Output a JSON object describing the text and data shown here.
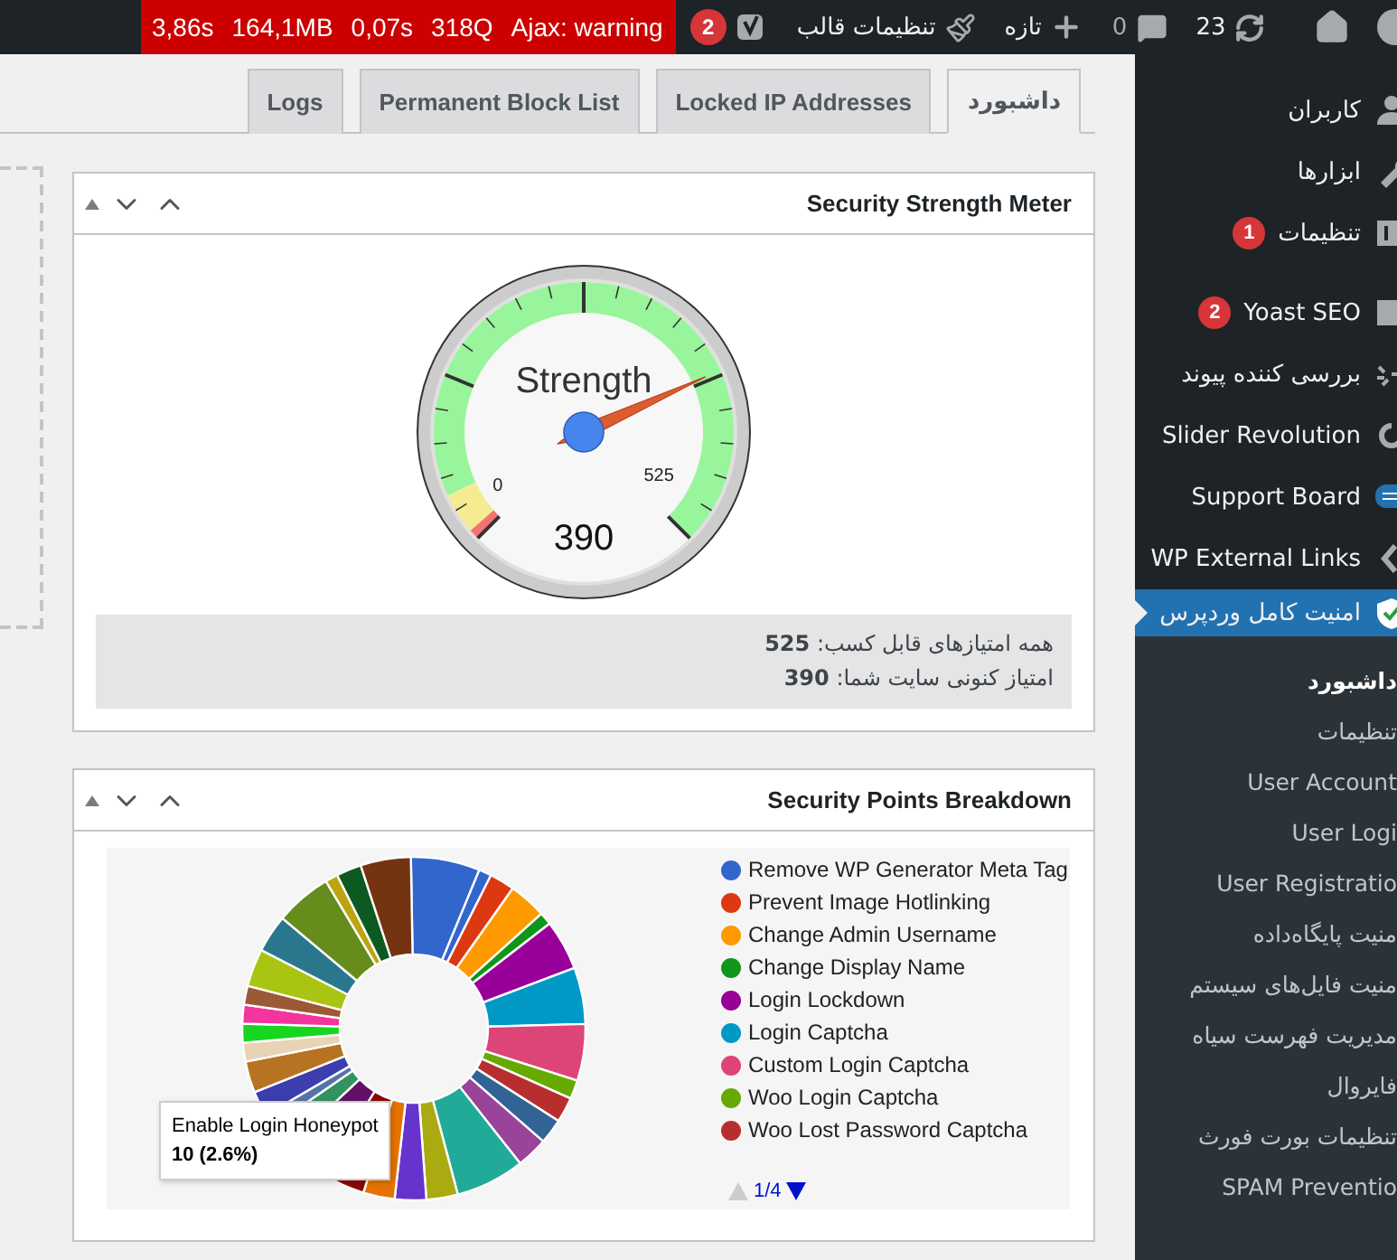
{
  "admin_bar": {
    "query_monitor": [
      "Ajax: warning",
      "318Q",
      "0,07s",
      "164,1MB",
      "3,86s"
    ],
    "yoast_badge": "2",
    "theme_settings": "تنظیمات قالب",
    "new": "تازه",
    "comments": "0",
    "updates": "23"
  },
  "sidebar": {
    "items": [
      {
        "label": "کاربران",
        "selected": false
      },
      {
        "label": "ابزارها",
        "selected": false
      },
      {
        "label": "تنظیمات",
        "badge": "1",
        "selected": false
      },
      {
        "label": "Yoast SEO",
        "badge": "2",
        "selected": false
      },
      {
        "label": "بررسی کننده پیوند",
        "selected": false
      },
      {
        "label": "Slider Revolution",
        "selected": false
      },
      {
        "label": "Support Board",
        "selected": false
      },
      {
        "label": "WP External Links",
        "selected": false
      },
      {
        "label": "امنیت کامل وردپرس",
        "selected": true
      }
    ],
    "submenu": [
      {
        "label": "داشبورد",
        "selected": true
      },
      {
        "label": "تنظیمات",
        "selected": false
      },
      {
        "label": "User Account",
        "selected": false
      },
      {
        "label": "User Logi",
        "selected": false
      },
      {
        "label": "User Registratio",
        "selected": false
      },
      {
        "label": "منیت پایگاه‌داده",
        "selected": false
      },
      {
        "label": "منیت فایل‌های سیستم",
        "selected": false
      },
      {
        "label": "مدیریت فهرست سیاه",
        "selected": false
      },
      {
        "label": "فایروال",
        "selected": false
      },
      {
        "label": "تنظیمات بورت فورث",
        "selected": false
      },
      {
        "label": "SPAM Preventio",
        "selected": false
      }
    ]
  },
  "tabs": [
    {
      "label": "داشبورد",
      "selected": true
    },
    {
      "label": "Locked IP Addresses",
      "selected": false
    },
    {
      "label": "Permanent Block List",
      "selected": false
    },
    {
      "label": "Logs",
      "selected": false
    }
  ],
  "strength_panel": {
    "title": "Security Strength Meter",
    "gauge": {
      "label": "Strength",
      "min": "0",
      "max": "525",
      "reading": "390",
      "level": 0.743
    },
    "summary": [
      "همه امتیازهای قابل کسب: **525**",
      "امتیاز کنونی سایت شما: **390**"
    ]
  },
  "breakdown_panel": {
    "title": "Security Points Breakdown",
    "legend": [
      {
        "label": "Remove WP Generator Meta Tag",
        "color": "#3366cc"
      },
      {
        "label": "Prevent Image Hotlinking",
        "color": "#dc3912"
      },
      {
        "label": "Change Admin Username",
        "color": "#ff9900"
      },
      {
        "label": "Change Display Name",
        "color": "#109618"
      },
      {
        "label": "Login Lockdown",
        "color": "#990099"
      },
      {
        "label": "Login Captcha",
        "color": "#0099c6"
      },
      {
        "label": "Custom Login Captcha",
        "color": "#dd4477"
      },
      {
        "label": "Woo Login Captcha",
        "color": "#66aa00"
      },
      {
        "label": "Woo Lost Password Captcha",
        "color": "#b82e2e"
      }
    ],
    "tooltip": {
      "title": "Enable Login Honeypot",
      "value": "10 (2.6%)"
    },
    "pager": "1/4"
  }
}
